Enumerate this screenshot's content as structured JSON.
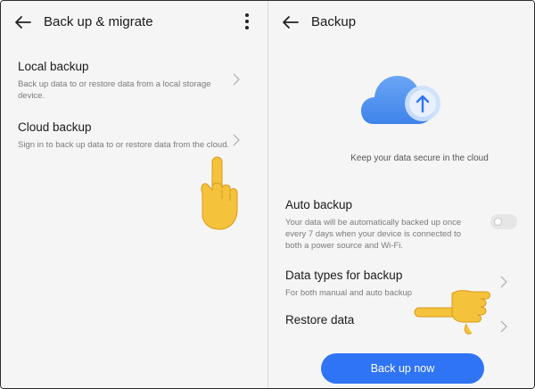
{
  "left": {
    "title": "Back up & migrate",
    "items": [
      {
        "label": "Local backup",
        "description": "Back up data to or restore data from a local storage device."
      },
      {
        "label": "Cloud backup",
        "description": "Sign in to back up data to or restore data from the cloud."
      }
    ]
  },
  "right": {
    "title": "Backup",
    "caption": "Keep your data secure in the cloud",
    "auto_backup": {
      "label": "Auto backup",
      "description": "Your data will be automatically backed up once every 7 days when your device is connected to both a power source and Wi-Fi.",
      "enabled": false
    },
    "items": [
      {
        "label": "Data types for backup",
        "description": "For both manual and auto backup"
      },
      {
        "label": "Restore data",
        "description": ""
      }
    ],
    "primary_button": "Back up now"
  },
  "colors": {
    "accent": "#2f74f5",
    "cloud": "#5a98f0",
    "pointer_hand": "#f5c33b"
  },
  "icons": [
    "back-arrow-icon",
    "more-vertical-icon",
    "chevron-right-icon",
    "cloud-upload-icon",
    "pointing-hand-icon"
  ]
}
